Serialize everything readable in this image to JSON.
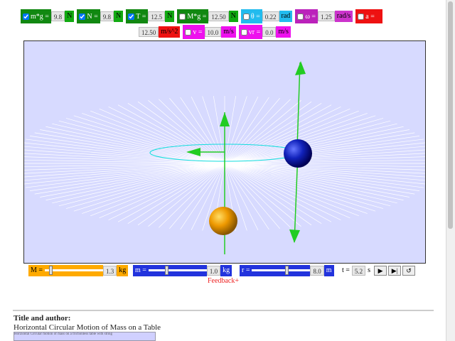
{
  "top_row1": [
    {
      "id": "mg",
      "label": "m*g =",
      "checked": true,
      "value": "9.8",
      "unit": "N",
      "color": "green"
    },
    {
      "id": "N",
      "label": "N =",
      "checked": true,
      "value": "9.8",
      "unit": "N",
      "color": "green"
    },
    {
      "id": "T",
      "label": "T =",
      "checked": true,
      "value": "12.5",
      "unit": "N",
      "color": "green"
    },
    {
      "id": "Mg",
      "label": "M*g =",
      "checked": false,
      "value": "12.50",
      "unit": "N",
      "color": "green"
    },
    {
      "id": "theta",
      "label": "θ =",
      "checked": false,
      "value": "0.22",
      "unit": "rad",
      "color": "cyan"
    },
    {
      "id": "omega",
      "label": "ω =",
      "checked": false,
      "value": "1.25",
      "unit": "rad/s",
      "color": "mag"
    },
    {
      "id": "a",
      "label": "a =",
      "checked": false,
      "value": "",
      "unit": "",
      "color": "red"
    }
  ],
  "top_row2": [
    {
      "id": "a2",
      "label": "",
      "value": "12.50",
      "unit": "m/s^2",
      "color": "red"
    },
    {
      "id": "v",
      "label": "v =",
      "checked": false,
      "value": "10.0",
      "unit": "m/s",
      "color": "magenta"
    },
    {
      "id": "vr",
      "label": "vr =",
      "checked": false,
      "value": "0.0",
      "unit": "m/s",
      "color": "magenta"
    }
  ],
  "controls": {
    "M": {
      "label": "M =",
      "value": "1.3",
      "unit": "kg",
      "fraction": 0.08
    },
    "m": {
      "label": "m =",
      "value": "1.0",
      "unit": "kg",
      "fraction": 0.3
    },
    "r": {
      "label": "r =",
      "value": "8.0",
      "unit": "m",
      "fraction": 0.6
    },
    "t": {
      "label": "t =",
      "value": "5.2",
      "unit": "s"
    }
  },
  "feedback": "Feedback+",
  "title_label": "Title and author:",
  "title_text": "Horizontal Circular Motion of Mass on a Table",
  "thumbnail_text": "Horizontal Circular motion of mass on a frictionless table with string",
  "colors": {
    "green": "#118811",
    "blue": "#2233dd",
    "orange": "#ffaa00"
  }
}
